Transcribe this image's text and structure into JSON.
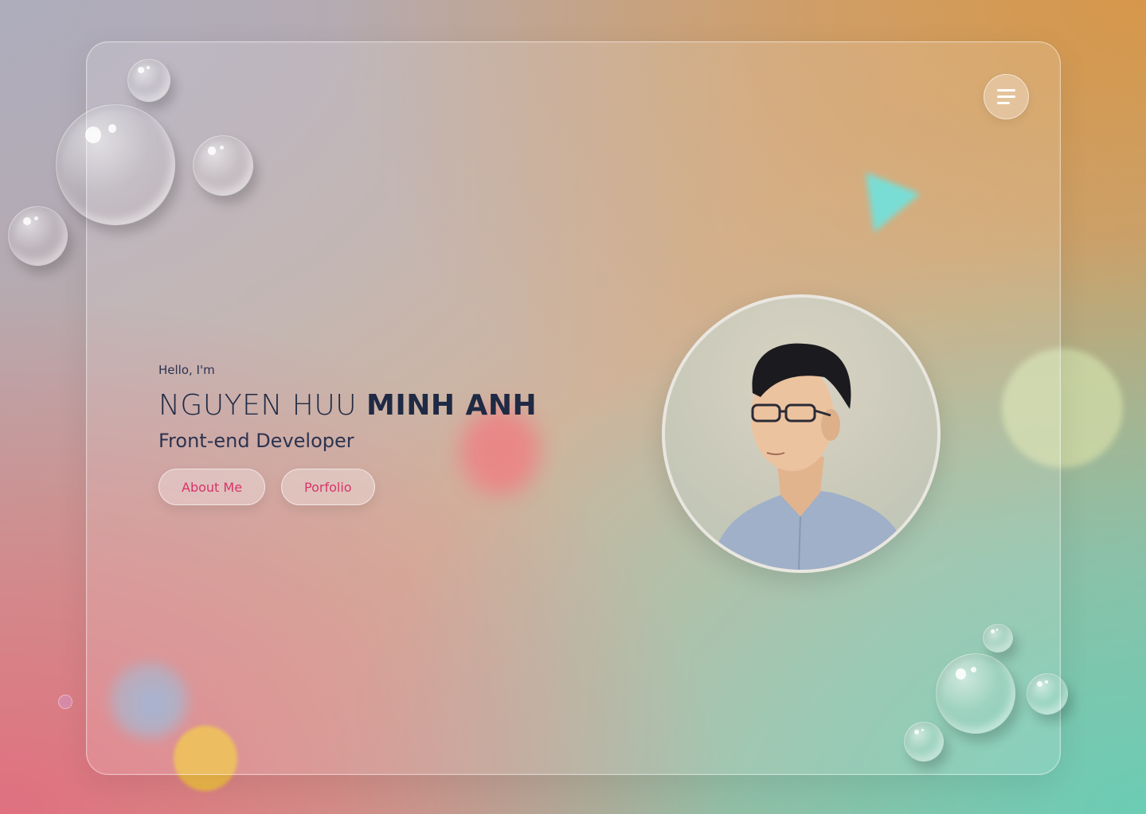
{
  "menu": {
    "icon": "hamburger-menu-icon"
  },
  "hero": {
    "greeting": "Hello, I'm",
    "name_regular": "NGUYEN HUU",
    "name_bold": "MINH ANH",
    "role": "Front-end Developer",
    "buttons": [
      {
        "label": "About Me"
      },
      {
        "label": "Porfolio"
      }
    ]
  },
  "portrait": {
    "icon": "profile-photo"
  },
  "colors": {
    "accent": "#d8336a",
    "text": "#1f2a44"
  }
}
